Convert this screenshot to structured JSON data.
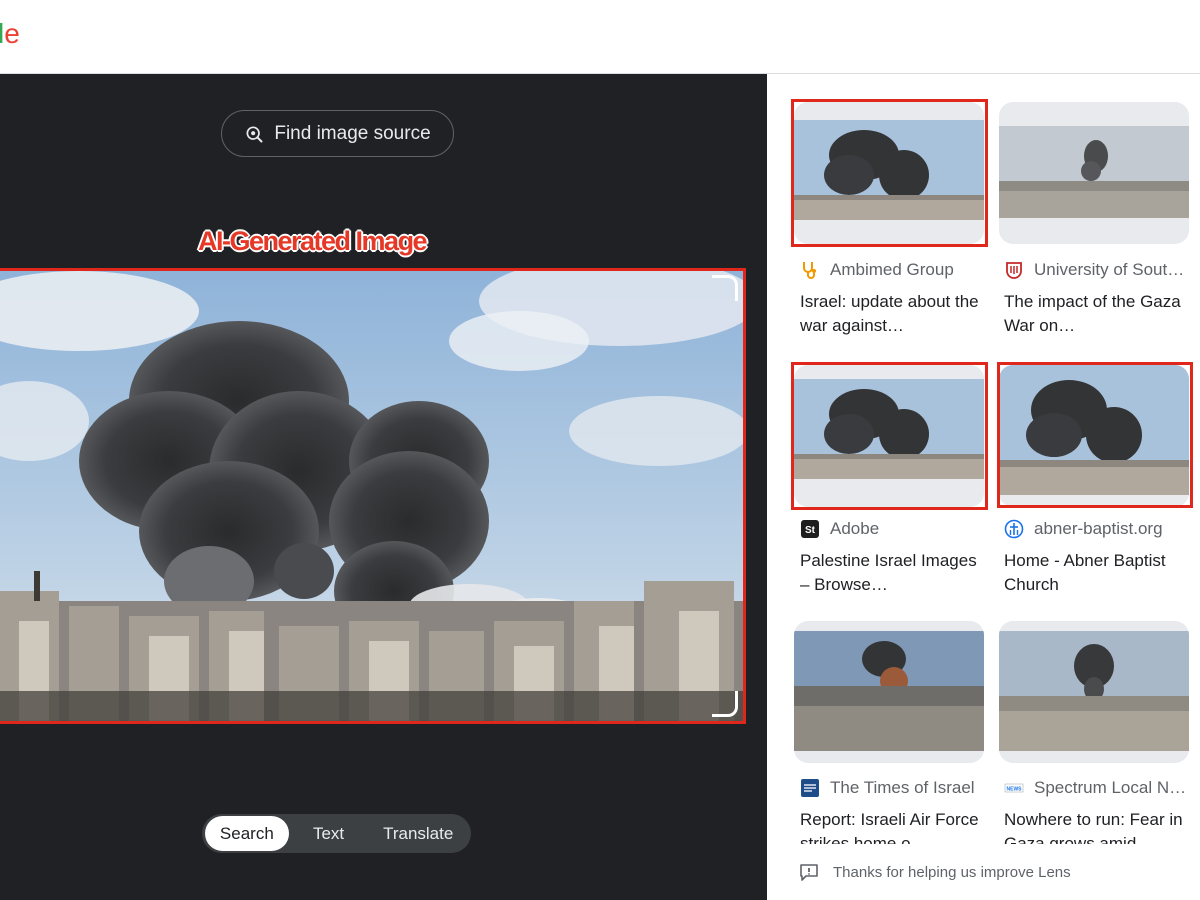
{
  "header": {
    "logo_partial_l": "l",
    "logo_partial_e": "e"
  },
  "viewer": {
    "find_source_label": "Find image source",
    "annotation_label": "AI-Generated Image",
    "tabs": [
      {
        "label": "Search",
        "active": true
      },
      {
        "label": "Text",
        "active": false
      },
      {
        "label": "Translate",
        "active": false
      }
    ]
  },
  "results": [
    {
      "source": "Ambimed Group",
      "title": "Israel: update about the war against…",
      "icon": "stethoscope-icon",
      "highlighted": true
    },
    {
      "source": "University of Sout…",
      "title": "The impact of the Gaza War on…",
      "icon": "university-crest-icon",
      "highlighted": false
    },
    {
      "source": "Adobe",
      "title": "Palestine Israel Images – Browse…",
      "icon": "adobe-stock-icon",
      "highlighted": true
    },
    {
      "source": "abner-baptist.org",
      "title": "Home - Abner Baptist Church",
      "icon": "church-icon",
      "highlighted": true
    },
    {
      "source": "The Times of Israel",
      "title": "Report: Israeli Air Force strikes home o…",
      "icon": "times-of-israel-icon",
      "highlighted": false
    },
    {
      "source": "Spectrum Local N…",
      "title": "Nowhere to run: Fear in Gaza grows amid…",
      "icon": "spectrum-news-icon",
      "highlighted": false
    }
  ],
  "footer": {
    "feedback_text": "Thanks for helping us improve Lens"
  },
  "colors": {
    "annotation_red": "#e0271b",
    "viewer_bg": "#202124"
  }
}
